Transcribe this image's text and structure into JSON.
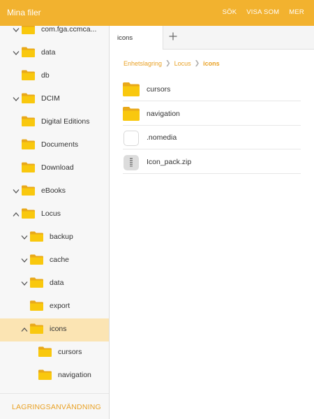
{
  "app": {
    "title": "Mina filer",
    "actions": [
      "SÖK",
      "VISA SOM",
      "MER"
    ]
  },
  "colors": {
    "accent": "#f2b22f",
    "folder": "#f9c80e",
    "selected_row": "#fbe4b3",
    "link": "#e9a124"
  },
  "sidebar": {
    "items": [
      {
        "label": "com.fga.ccmca...",
        "expanded": true
      },
      {
        "label": "data",
        "expanded": true
      },
      {
        "label": "db",
        "expanded": null
      },
      {
        "label": "DCIM",
        "expanded": true
      },
      {
        "label": "Digital Editions",
        "expanded": null
      },
      {
        "label": "Documents",
        "expanded": null
      },
      {
        "label": "Download",
        "expanded": null
      },
      {
        "label": "eBooks",
        "expanded": true
      },
      {
        "label": "Locus",
        "expanded": false
      },
      {
        "label": "backup",
        "expanded": true
      },
      {
        "label": "cache",
        "expanded": true
      },
      {
        "label": "data",
        "expanded": true
      },
      {
        "label": "export",
        "expanded": null
      },
      {
        "label": "icons",
        "expanded": false,
        "selected": true
      },
      {
        "label": "cursors",
        "expanded": null
      },
      {
        "label": "navigation",
        "expanded": null
      }
    ],
    "storage_button": "LAGRINGSANVÄNDNING"
  },
  "tabs": {
    "items": [
      {
        "label": "icons"
      }
    ],
    "add_icon": "plus-icon"
  },
  "breadcrumb": {
    "items": [
      "Enhetslagring",
      "Locus",
      "icons"
    ]
  },
  "files": {
    "items": [
      {
        "name": "cursors",
        "type": "folder"
      },
      {
        "name": "navigation",
        "type": "folder"
      },
      {
        "name": ".nomedia",
        "type": "file"
      },
      {
        "name": "Icon_pack.zip",
        "type": "zip"
      }
    ]
  }
}
